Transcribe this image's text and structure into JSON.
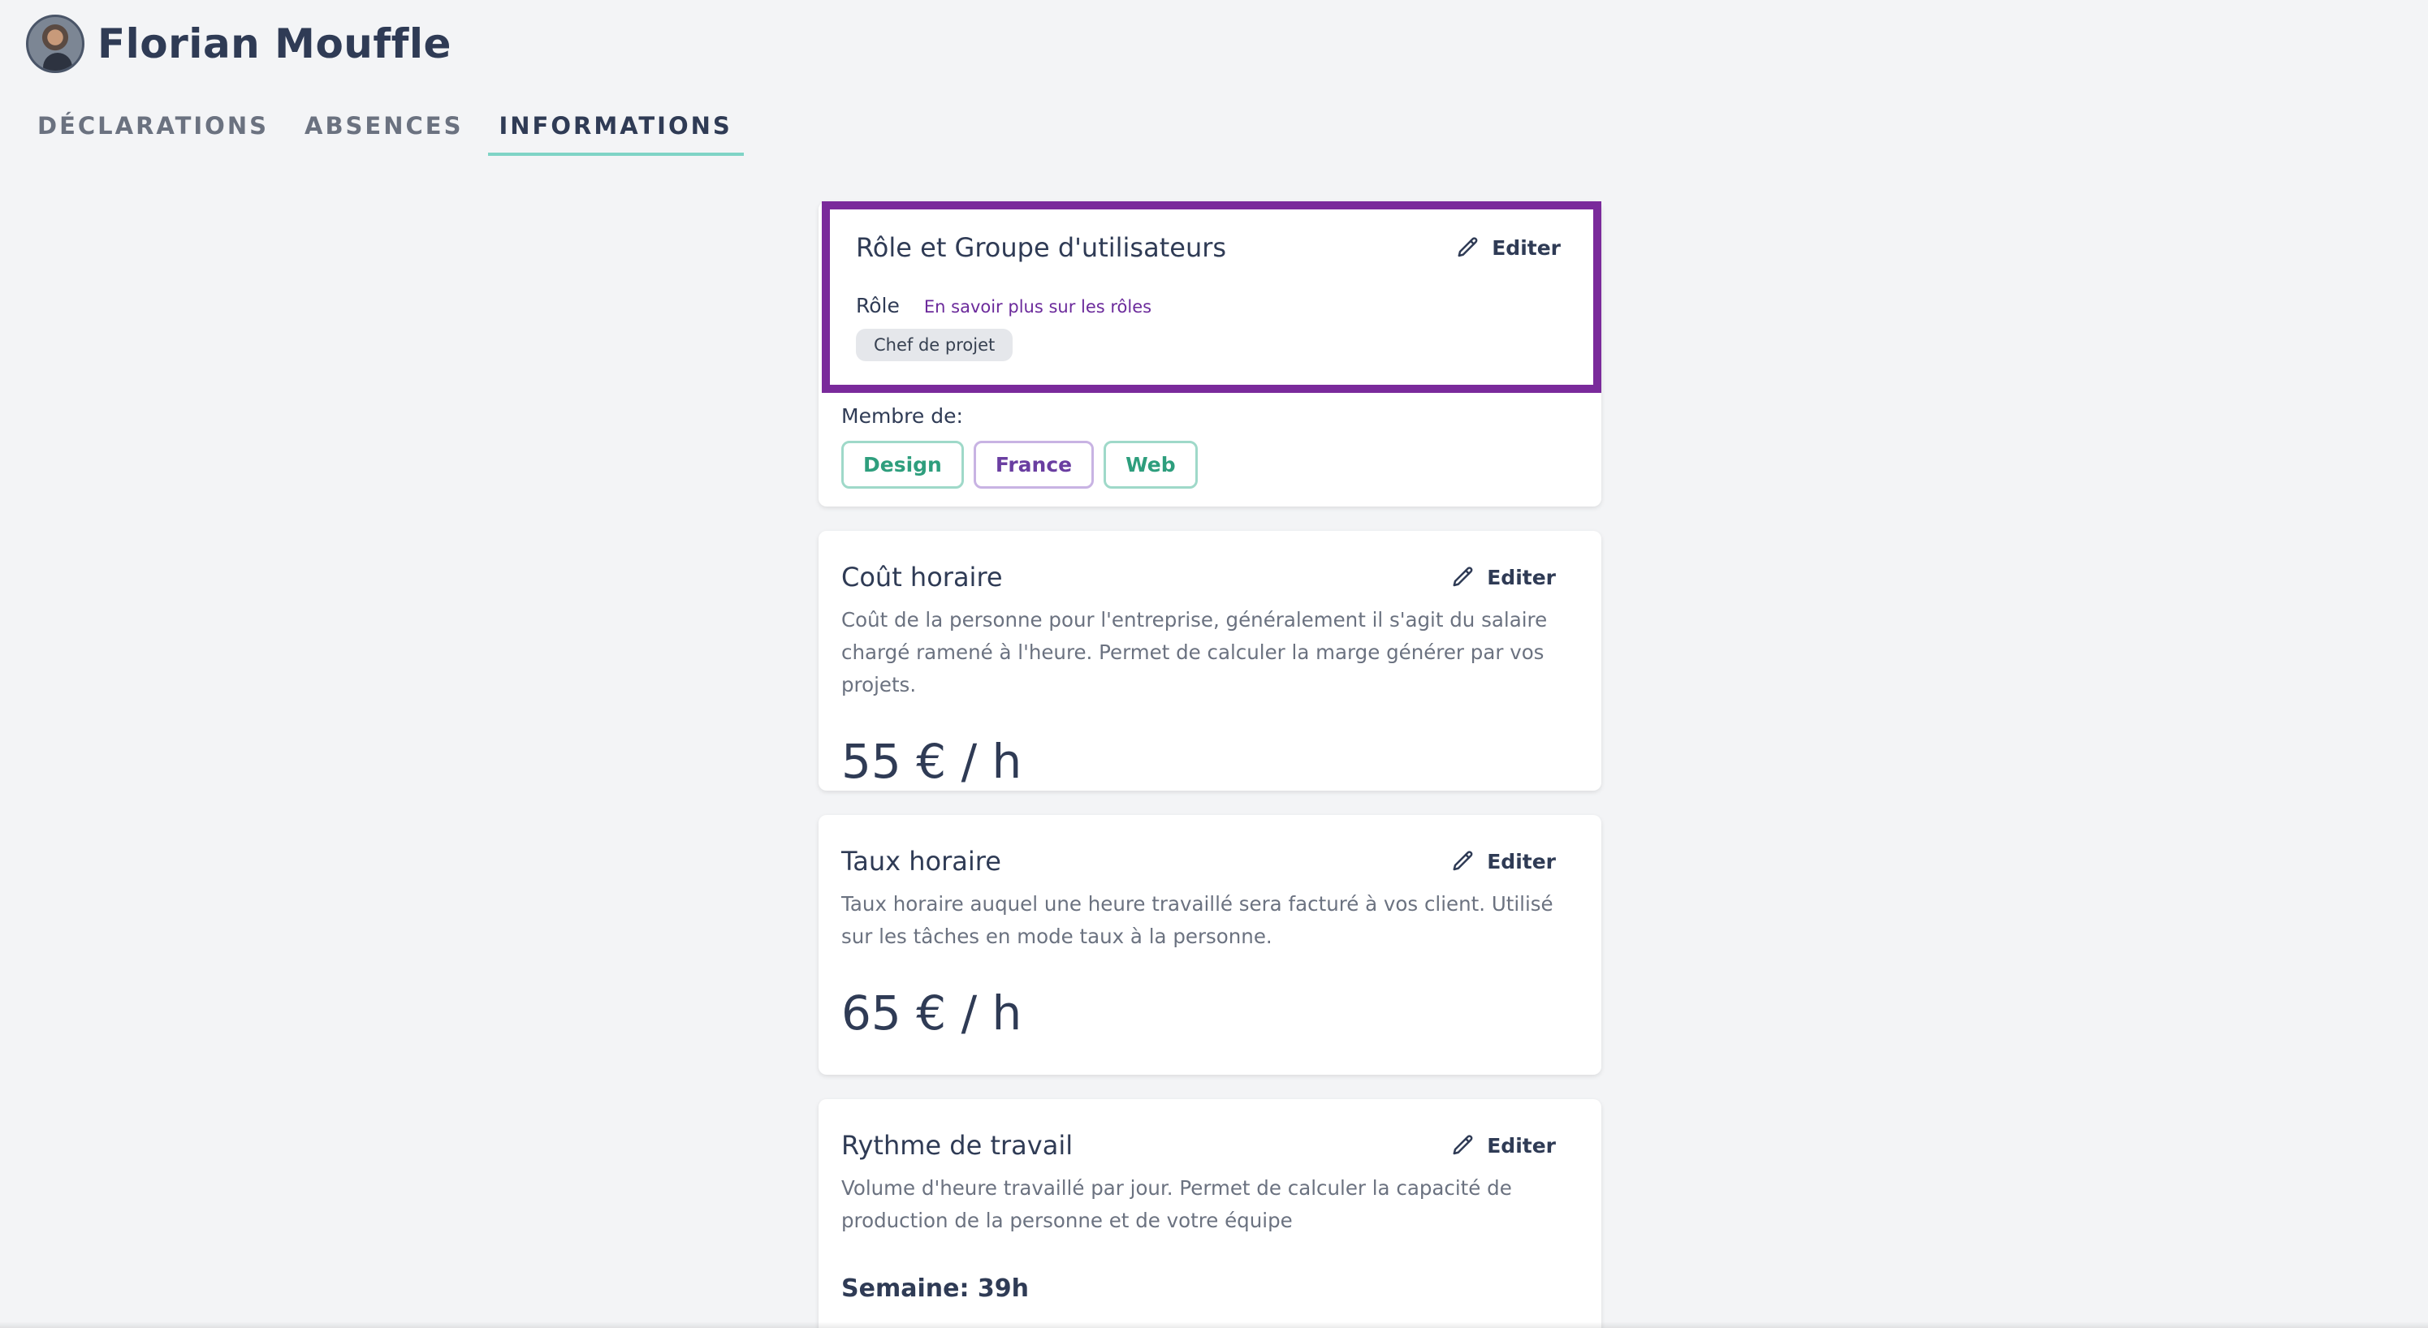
{
  "header": {
    "user_name": "Florian Mouffle",
    "avatar_icon": "user-avatar"
  },
  "tabs": [
    {
      "label": "DÉCLARATIONS",
      "active": false
    },
    {
      "label": "ABSENCES",
      "active": false
    },
    {
      "label": "INFORMATIONS",
      "active": true
    }
  ],
  "role_card": {
    "title": "Rôle et Groupe d'utilisateurs",
    "edit_label": "Editer",
    "role_label": "Rôle",
    "role_link": "En savoir plus sur les rôles",
    "role_value": "Chef de projet",
    "member_label": "Membre de:",
    "groups": [
      {
        "name": "Design",
        "color": "#2e9e7d",
        "border": "#9fd9c9"
      },
      {
        "name": "France",
        "color": "#6a3ea1",
        "border": "#c8b3e3"
      },
      {
        "name": "Web",
        "color": "#2e9e7d",
        "border": "#9fd9c9"
      }
    ],
    "highlight_color": "#7a2a9b"
  },
  "cost_card": {
    "title": "Coût horaire",
    "edit_label": "Editer",
    "description": "Coût de la personne pour l'entreprise, généralement il s'agit du salaire chargé ramené à l'heure. Permet de calculer la marge générer par vos projets.",
    "value": "55 € / h"
  },
  "rate_card": {
    "title": "Taux horaire",
    "edit_label": "Editer",
    "description": "Taux horaire auquel une heure travaillé sera facturé à vos client. Utilisé sur les tâches en mode taux à la personne.",
    "value": "65 € / h"
  },
  "rhythm_card": {
    "title": "Rythme de travail",
    "edit_label": "Editer",
    "description": "Volume d'heure travaillé par jour. Permet de calculer la capacité de production de la personne et de votre équipe",
    "value": "Semaine: 39h"
  },
  "colors": {
    "background": "#f3f4f6",
    "text": "#2f3b55",
    "tab_underline": "#7fd4c6",
    "link": "#6b2a9b"
  }
}
